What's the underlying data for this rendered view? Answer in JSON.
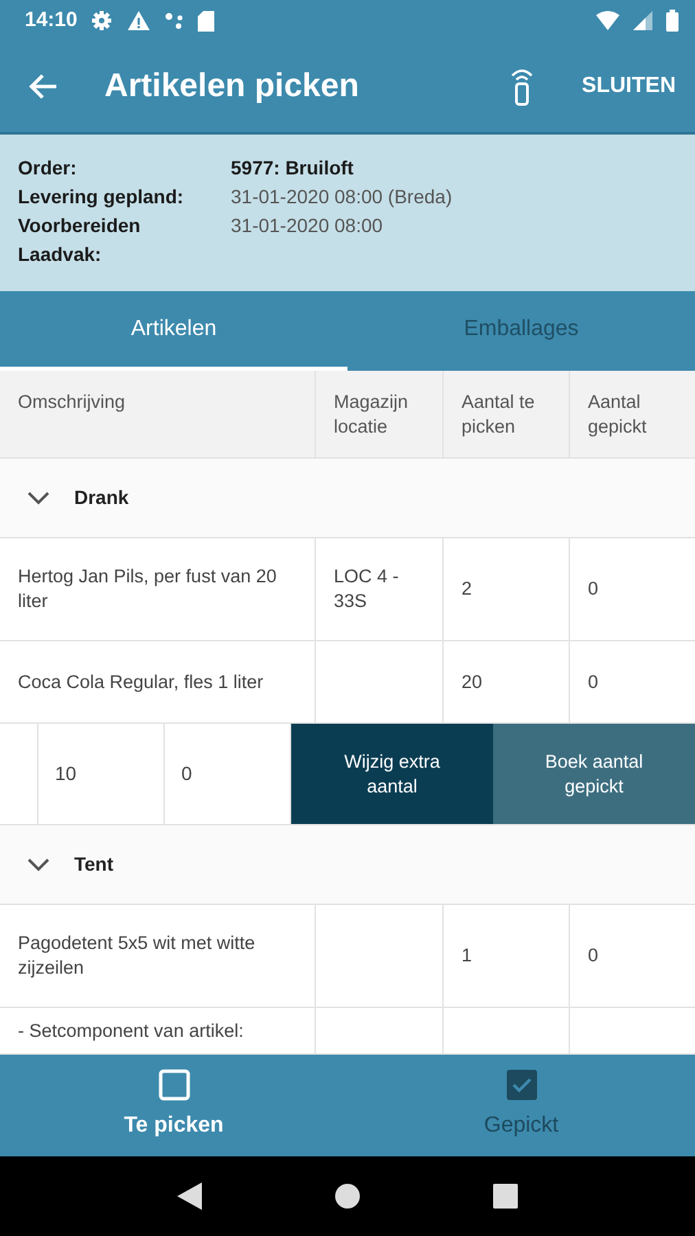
{
  "status_bar": {
    "time": "14:10"
  },
  "app_bar": {
    "title": "Artikelen picken",
    "action": "SLUITEN"
  },
  "order_info": [
    {
      "label": "Order:",
      "value": "5977: Bruiloft",
      "emphasis": true
    },
    {
      "label": "Levering gepland:",
      "value": "31-01-2020 08:00 (Breda)",
      "emphasis": false
    },
    {
      "label": "Voorbereiden",
      "value": "31-01-2020 08:00",
      "emphasis": false
    },
    {
      "label": "Laadvak:"
    }
  ],
  "tabs": [
    {
      "label": "Artikelen",
      "selected": true
    },
    {
      "label": "Emballages",
      "selected": false
    }
  ],
  "table": {
    "columns": [
      "Omschrijving",
      "Magazijn locatie",
      "Aantal te picken",
      "Aantal gepickt"
    ],
    "rows": [
      {
        "kind": "group",
        "label": "Drank",
        "expanded": true
      },
      {
        "kind": "item",
        "cells": [
          "Hertog Jan Pils, per fust van 20 liter",
          "LOC 4 - 33S",
          "2",
          "0"
        ]
      },
      {
        "kind": "item",
        "cells": [
          "Coca Cola Regular, fles 1 liter",
          "",
          "20",
          "0"
        ]
      },
      {
        "kind": "swiped",
        "cells": [
          "10",
          "0"
        ],
        "actions": [
          "Wijzig extra aantal",
          "Boek aantal gepickt"
        ]
      },
      {
        "kind": "group",
        "label": "Tent",
        "expanded": true
      },
      {
        "kind": "item",
        "cells": [
          "Pagodetent 5x5 wit met witte zijzeilen",
          "",
          "1",
          "0"
        ]
      },
      {
        "kind": "item",
        "cells": [
          "- Setcomponent van artikel:",
          "",
          "",
          ""
        ]
      }
    ]
  },
  "bottom_nav": [
    {
      "label": "Te picken",
      "selected": true,
      "kind": "unchecked"
    },
    {
      "label": "Gepickt",
      "selected": false,
      "kind": "checked"
    }
  ]
}
